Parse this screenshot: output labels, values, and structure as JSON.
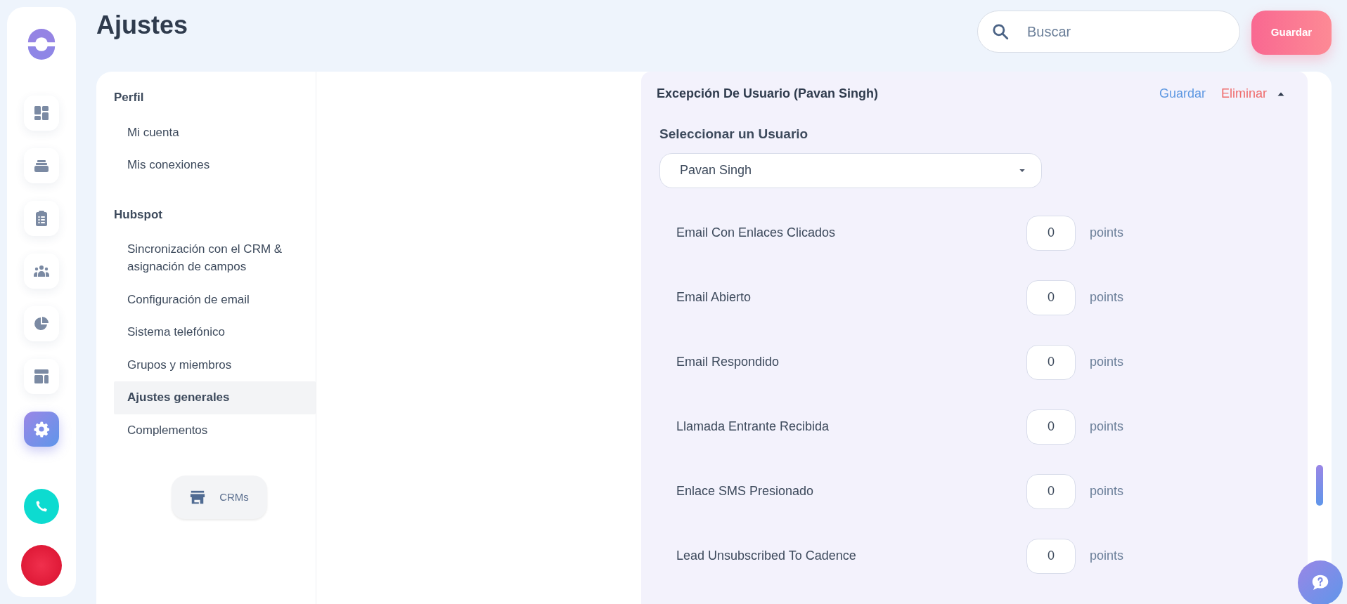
{
  "rail": {
    "nav_items": [
      {
        "selected": false
      },
      {
        "selected": false
      },
      {
        "selected": false
      },
      {
        "selected": false
      },
      {
        "selected": false
      },
      {
        "selected": false
      },
      {
        "selected": true
      }
    ]
  },
  "header": {
    "title": "Ajustes",
    "search": {
      "placeholder": "Buscar"
    },
    "save_button": "Guardar"
  },
  "settings_nav": {
    "sections": [
      {
        "title": "Perfil",
        "items": [
          {
            "label": "Mi cuenta",
            "selected": false
          },
          {
            "label": "Mis conexiones",
            "selected": false
          }
        ]
      },
      {
        "title": "Hubspot",
        "items": [
          {
            "label": "Sincronización con el CRM & asignación de campos",
            "selected": false
          },
          {
            "label": "Configuración de email",
            "selected": false
          },
          {
            "label": "Sistema telefónico",
            "selected": false
          },
          {
            "label": "Grupos y miembros",
            "selected": false
          },
          {
            "label": "Ajustes generales",
            "selected": true
          },
          {
            "label": "Complementos",
            "selected": false
          }
        ]
      }
    ],
    "crm_button": "CRMs"
  },
  "exception_panel": {
    "title": "Excepción De Usuario (Pavan Singh)",
    "save_link": "Guardar",
    "delete_link": "Eliminar",
    "expanded": true,
    "select_label": "Seleccionar un Usuario",
    "select_value": "Pavan Singh",
    "rows": [
      {
        "label": "Email Con Enlaces Clicados",
        "value": "0",
        "unit": "points"
      },
      {
        "label": "Email Abierto",
        "value": "0",
        "unit": "points"
      },
      {
        "label": "Email Respondido",
        "value": "0",
        "unit": "points"
      },
      {
        "label": "Llamada Entrante Recibida",
        "value": "0",
        "unit": "points"
      },
      {
        "label": "Enlace SMS Presionado",
        "value": "0",
        "unit": "points"
      },
      {
        "label": "Lead Unsubscribed To Cadence",
        "value": "0",
        "unit": "points"
      }
    ]
  }
}
